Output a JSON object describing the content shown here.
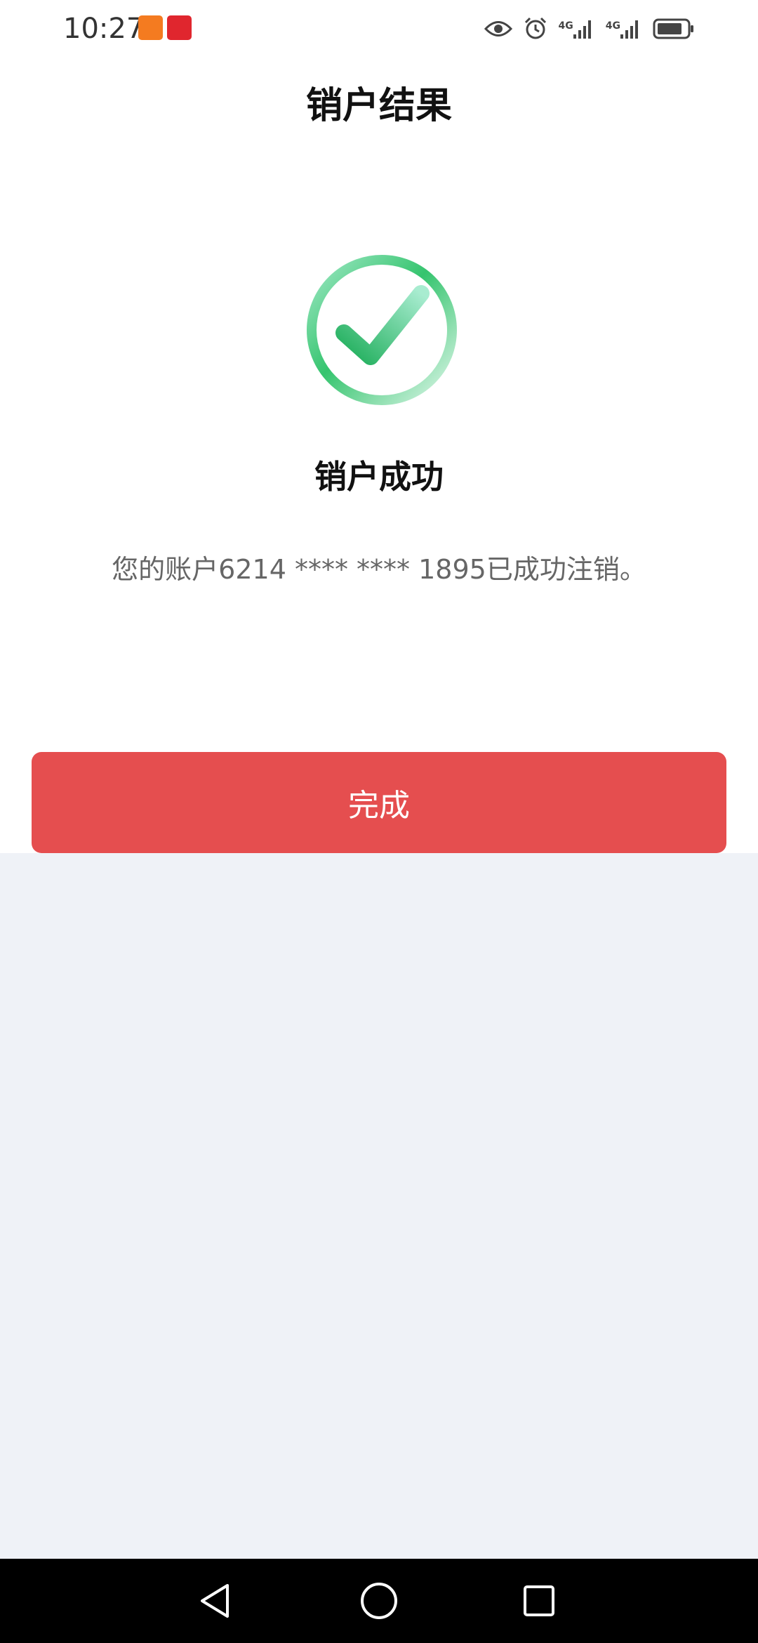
{
  "status_bar": {
    "time": "10:27",
    "network_1": "4G",
    "network_2": "4G"
  },
  "header": {
    "title": "销户结果"
  },
  "result": {
    "status_icon": "check-circle-icon",
    "title": "销户成功",
    "message": "您的账户6214 **** **** 1895已成功注销。"
  },
  "actions": {
    "done_label": "完成"
  },
  "colors": {
    "primary": "#e54e4f",
    "success": "#2ec46b",
    "page_background": "#eff2f7"
  },
  "navigation": {
    "back_icon": "back-triangle-icon",
    "home_icon": "home-circle-icon",
    "recent_icon": "recent-square-icon"
  }
}
